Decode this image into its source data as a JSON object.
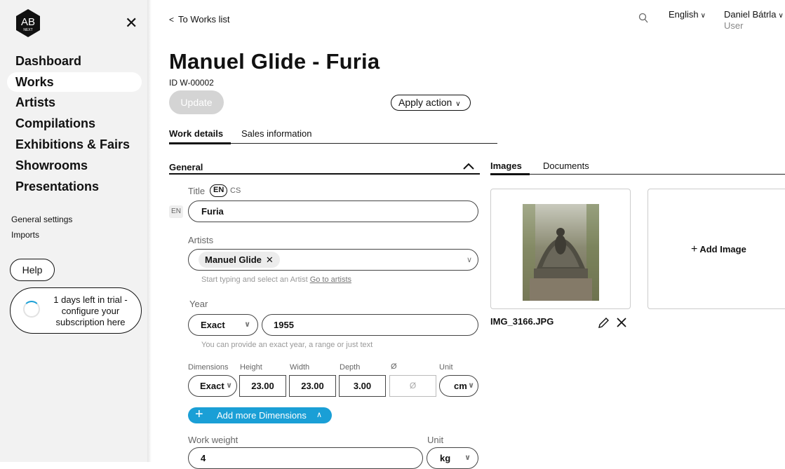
{
  "sidebar": {
    "logo_text": "AB",
    "logo_subtext": "NEXT",
    "nav_items": [
      {
        "label": "Dashboard"
      },
      {
        "label": "Works"
      },
      {
        "label": "Artists"
      },
      {
        "label": "Compilations"
      },
      {
        "label": "Exhibitions & Fairs"
      },
      {
        "label": "Showrooms"
      },
      {
        "label": "Presentations"
      }
    ],
    "general_settings": "General settings",
    "imports": "Imports",
    "help_label": "Help",
    "trial_text": "1 days left in trial - configure your subscription here"
  },
  "topbar": {
    "back_link": "To Works list",
    "language": "English",
    "user_name": "Daniel Bátrla",
    "user_role": "User"
  },
  "work": {
    "title": "Manuel Glide - Furia",
    "id_label": "ID W-00002",
    "update_label": "Update",
    "apply_action_label": "Apply action"
  },
  "tabs": [
    {
      "label": "Work details"
    },
    {
      "label": "Sales information"
    }
  ],
  "general": {
    "section_title": "General",
    "title_label": "Title",
    "lang_en": "EN",
    "lang_cs": "CS",
    "field_lang": "EN",
    "title_value": "Furia",
    "artists_label": "Artists",
    "artist_chip": "Manuel Glide",
    "artists_hint": "Start typing and select an Artist",
    "go_to_artists": "Go to artists",
    "year_label": "Year",
    "year_mode": "Exact",
    "year_value": "1955",
    "year_hint": "You can provide an exact year, a range or just text",
    "dimensions_label": "Dimensions",
    "height_label": "Height",
    "width_label": "Width",
    "depth_label": "Depth",
    "diameter_label": "Ø",
    "unit_label": "Unit",
    "dim_mode": "Exact",
    "height_value": "23.00",
    "width_value": "23.00",
    "depth_value": "3.00",
    "diameter_placeholder": "Ø",
    "dim_unit": "cm",
    "add_more_dimensions": "Add more Dimensions",
    "weight_label": "Work weight",
    "weight_unit_label": "Unit",
    "weight_value": "4",
    "weight_unit": "kg"
  },
  "media": {
    "tabs": [
      {
        "label": "Images"
      },
      {
        "label": "Documents"
      }
    ],
    "image_name": "IMG_3166.JPG",
    "add_image_label": "Add Image"
  },
  "colors": {
    "accent": "#1a9fd6",
    "disabled_button": "#d4d4d4",
    "sidebar_bg": "#f2f2f2"
  }
}
